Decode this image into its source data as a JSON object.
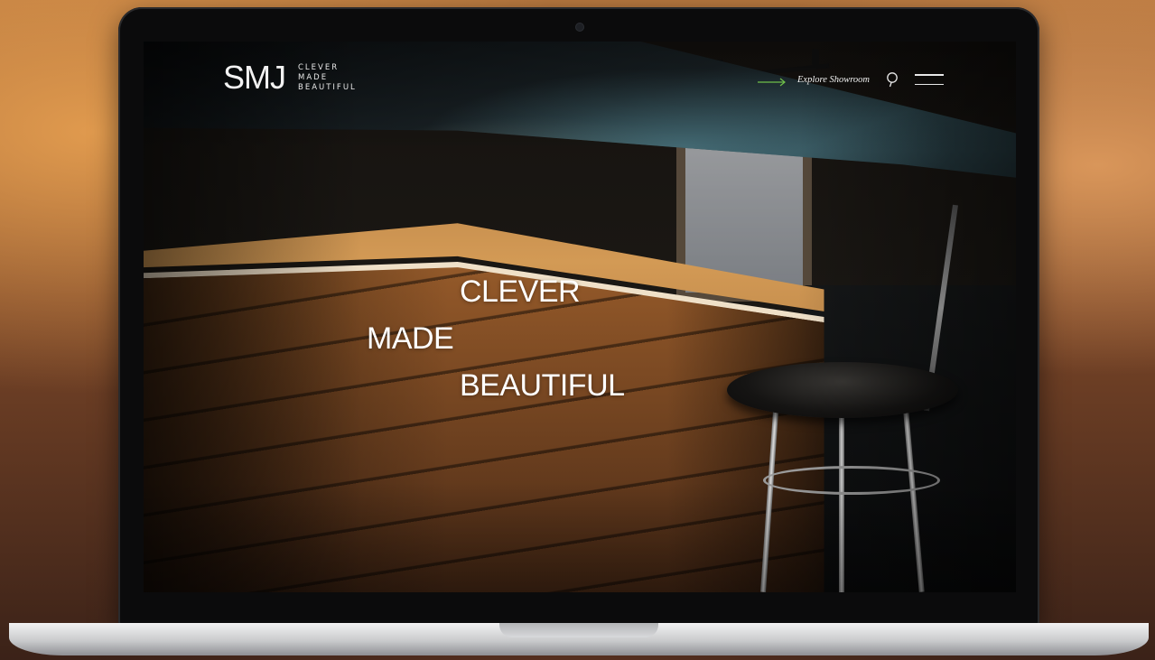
{
  "site": {
    "logo_mark": "SMJ",
    "logo_words": [
      "CLEVER",
      "MADE",
      "BEAUTIFUL"
    ]
  },
  "nav": {
    "explore_label": "Explore Showroom",
    "arrow_icon": "arrow-right-icon",
    "search_icon": "search-icon",
    "menu_icon": "hamburger-menu-icon",
    "accent_color": "#6fbf4a"
  },
  "hero": {
    "lines": [
      "CLEVER",
      "MADE",
      "BEAUTIFUL"
    ]
  }
}
